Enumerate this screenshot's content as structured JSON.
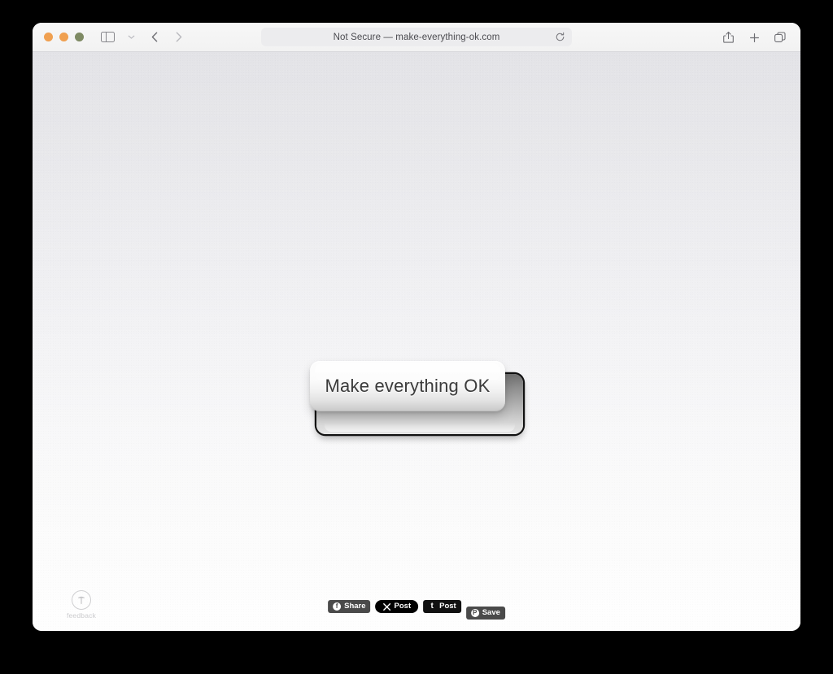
{
  "browser": {
    "traffic_lights": [
      {
        "name": "close",
        "color": "#f0a050"
      },
      {
        "name": "minimize",
        "color": "#f0a050"
      },
      {
        "name": "zoom",
        "color": "#7e8a63"
      }
    ],
    "toolbar": {
      "sidebar_toggle": "sidebar-toggle",
      "sidebar_dropdown": "chevron-down",
      "back": "back-arrow",
      "forward": "forward-arrow",
      "share": "share-icon",
      "new_tab": "plus-icon",
      "tab_overview": "tabs-icon"
    },
    "address_bar": {
      "security_label": "Not Secure",
      "separator": "—",
      "domain": "make-everything-ok.com",
      "full_text": "Not Secure — make-everything-ok.com",
      "reload_icon": "reload-icon"
    }
  },
  "page": {
    "background_top_color": "#e3e3e7",
    "background_bottom_color": "#fefefe",
    "main_button": {
      "label": "Make everything OK",
      "text_color": "#3b3b3b",
      "cap_color": "#fbfbfb",
      "base_color": "#111111"
    },
    "feedback": {
      "label": "feedback",
      "icon": "tree-in-circle-icon"
    },
    "social_buttons": [
      {
        "id": "facebook",
        "glyph": "f",
        "label": "Share",
        "color": "#4a4a4a"
      },
      {
        "id": "x",
        "glyph": "𝕏",
        "label": "Post",
        "color": "#000000"
      },
      {
        "id": "tumblr",
        "glyph": "t",
        "label": "Post",
        "color": "#111111"
      },
      {
        "id": "pinterest",
        "glyph": "P",
        "label": "Save",
        "color": "#4a4a4a"
      }
    ]
  }
}
